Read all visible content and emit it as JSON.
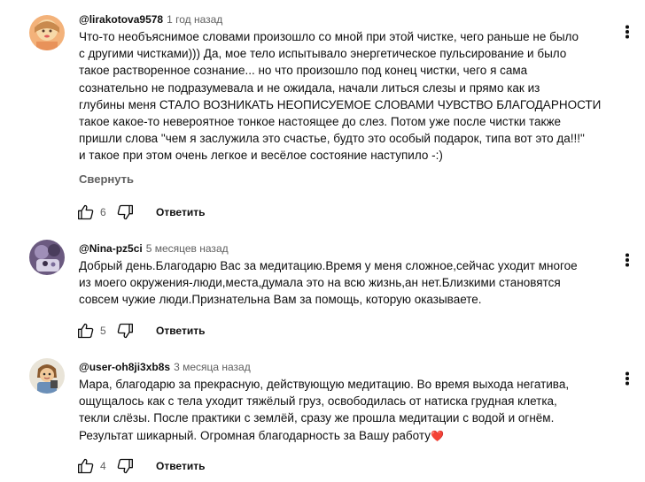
{
  "comments": [
    {
      "author": "@lirakotova9578",
      "time": "1 год назад",
      "text": "Что-то необъяснимое словами произошло со мной при этой чистке, чего раньше не было\nс другими чистками))) Да, мое тело испытывало энергетическое пульсирование и было\nтакое растворенное сознание... но что произошло под конец чистки, чего я сама\nсознательно не подразумевала и не ожидала, начали литься слезы и прямо как из\nглубины меня СТАЛО ВОЗНИКАТЬ НЕОПИСУЕМОЕ СЛОВАМИ ЧУВСТВО БЛАГОДАРНОСТИ\nтакое какое-то невероятное тонкое настоящее до слез. Потом уже после чистки также\nпришли слова \"чем я заслужила это счастье, будто это особый подарок, типа вот это да!!!\"\nи такое при этом очень легкое и весёлое состояние наступило -:)",
      "collapse": "Свернуть",
      "likes": "6",
      "reply": "Ответить"
    },
    {
      "author": "@Nina-pz5ci",
      "time": "5 месяцев назад",
      "text": "Добрый день.Благодарю Вас за медитацию.Время у меня сложное,сейчас уходит многое\nиз моего  окружения-люди,места,думала это на всю жизнь,ан нет.Близкими становятся\nсовсем чужие люди.Признательна Вам за помощь, которую оказываете.",
      "likes": "5",
      "reply": "Ответить"
    },
    {
      "author": "@user-oh8ji3xb8s",
      "time": "3 месяца назад",
      "text": "Мара, благодарю за прекрасную, действующую медитацию. Во время выхода негатива,\nощущалось как с тела уходит тяжёлый груз, освободилась от натиска грудная клетка,\nтекли слёзы.  После практики с землёй,  сразу же прошла медитации с водой и огнём.\nРезультат шикарный.  Огромная благодарность за Вашу работу",
      "emoji": "❤️",
      "likes": "4",
      "reply": "Ответить"
    }
  ],
  "icons": {
    "like": "thumb-up-icon",
    "dislike": "thumb-down-icon",
    "menu": "more-vertical-icon",
    "heart": "red-heart-emoji"
  },
  "colors": {
    "text": "#0f0f0f",
    "secondary": "#606060",
    "heart": "#e0243b"
  }
}
